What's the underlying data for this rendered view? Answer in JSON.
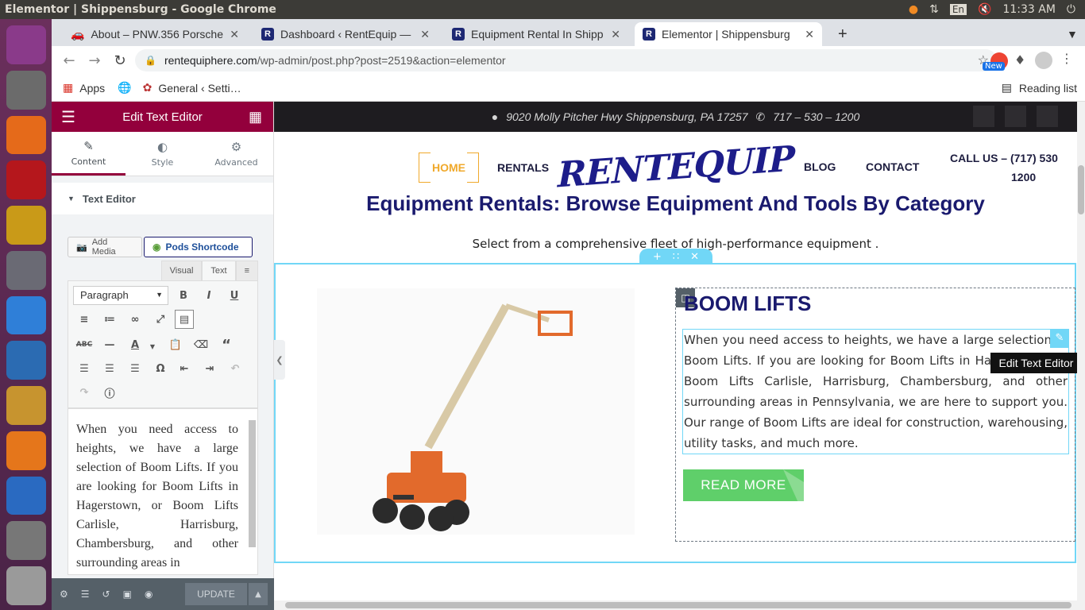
{
  "os": {
    "window_title": "Elementor | Shippensburg - Google Chrome",
    "keyboard_layout": "En",
    "time": "11:33 AM"
  },
  "launcher": {
    "apps": [
      {
        "name": "ubuntu-dash-icon",
        "color": "#8a3a8a"
      },
      {
        "name": "files-icon",
        "color": "#6b6b6b"
      },
      {
        "name": "firefox-icon",
        "color": "#e56a1a"
      },
      {
        "name": "filezilla-icon",
        "color": "#b5171c"
      },
      {
        "name": "teapot-icon",
        "color": "#c99a18"
      },
      {
        "name": "settings-icon",
        "color": "#6a6a74"
      },
      {
        "name": "chrome-icon",
        "color": "#2f7fd8"
      },
      {
        "name": "thunderbird-icon",
        "color": "#2b6bb2"
      },
      {
        "name": "lopin-icon",
        "color": "#c7942f"
      },
      {
        "name": "flame-icon",
        "color": "#e5761b"
      },
      {
        "name": "writer-icon",
        "color": "#2a6ac1"
      },
      {
        "name": "disk-icon",
        "color": "#777777"
      },
      {
        "name": "scanner-icon",
        "color": "#9a9a9a"
      }
    ]
  },
  "browser": {
    "tabs": [
      {
        "title": "About – PNW.356 Porsche",
        "favicon": "car-icon"
      },
      {
        "title": "Dashboard ‹ RentEquip —",
        "favicon": "R"
      },
      {
        "title": "Equipment Rental In Shipp",
        "favicon": "R"
      },
      {
        "title": "Elementor | Shippensburg",
        "favicon": "R"
      }
    ],
    "url_domain": "rentequiphere.com",
    "url_path": "/wp-admin/post.php?post=2519&action=elementor",
    "new_badge": "New",
    "bookmarks": {
      "apps": "Apps",
      "general": "General ‹ Setti…"
    },
    "reading_list": "Reading list"
  },
  "panel": {
    "title": "Edit Text Editor",
    "tabs": {
      "content": "Content",
      "style": "Style",
      "advanced": "Advanced"
    },
    "section": "Text Editor",
    "add_media": "Add Media",
    "pods_shortcode": "Pods Shortcode",
    "mode_visual": "Visual",
    "mode_text": "Text",
    "format_select": "Paragraph",
    "editor_text": "When you need access to heights, we have a large selection of Boom Lifts. If you are looking for Boom Lifts in Hagerstown, or Boom Lifts Carlisle, Harrisburg, Chambersburg, and other surrounding areas in",
    "update": "UPDATE"
  },
  "site": {
    "address": "9020 Molly Pitcher Hwy Shippensburg, PA 17257",
    "phone": "717 – 530 – 1200",
    "nav": {
      "home": "HOME",
      "rentals": "RENTALS",
      "blog": "BLOG",
      "contact": "CONTACT",
      "call_line1": "CALL US – (717) 530",
      "call_line2": "1200"
    },
    "logo_text": "RENTEQUIP",
    "heading": "Equipment Rentals: Browse Equipment And Tools By Category",
    "subheading": "Select from a comprehensive fleet of high-performance equipment .",
    "category_title": "BOOM LIFTS",
    "category_text": "When you need access to heights, we have a large selection of Boom Lifts. If you are looking for Boom Lifts in Hagerstown, or Boom Lifts Carlisle, Harrisburg, Chambersburg, and other surrounding areas in Pennsylvania, we are here to support you. Our range of Boom Lifts are ideal for construction, warehousing, utility tasks, and much more.",
    "read_more": "READ MORE",
    "tooltip": "Edit Text Editor"
  },
  "colors": {
    "elementor_accent": "#93003c",
    "site_navy": "#1a1a6e",
    "home_orange": "#f0a92b",
    "button_green": "#5fcf6a",
    "edit_blue": "#71d7f7"
  }
}
